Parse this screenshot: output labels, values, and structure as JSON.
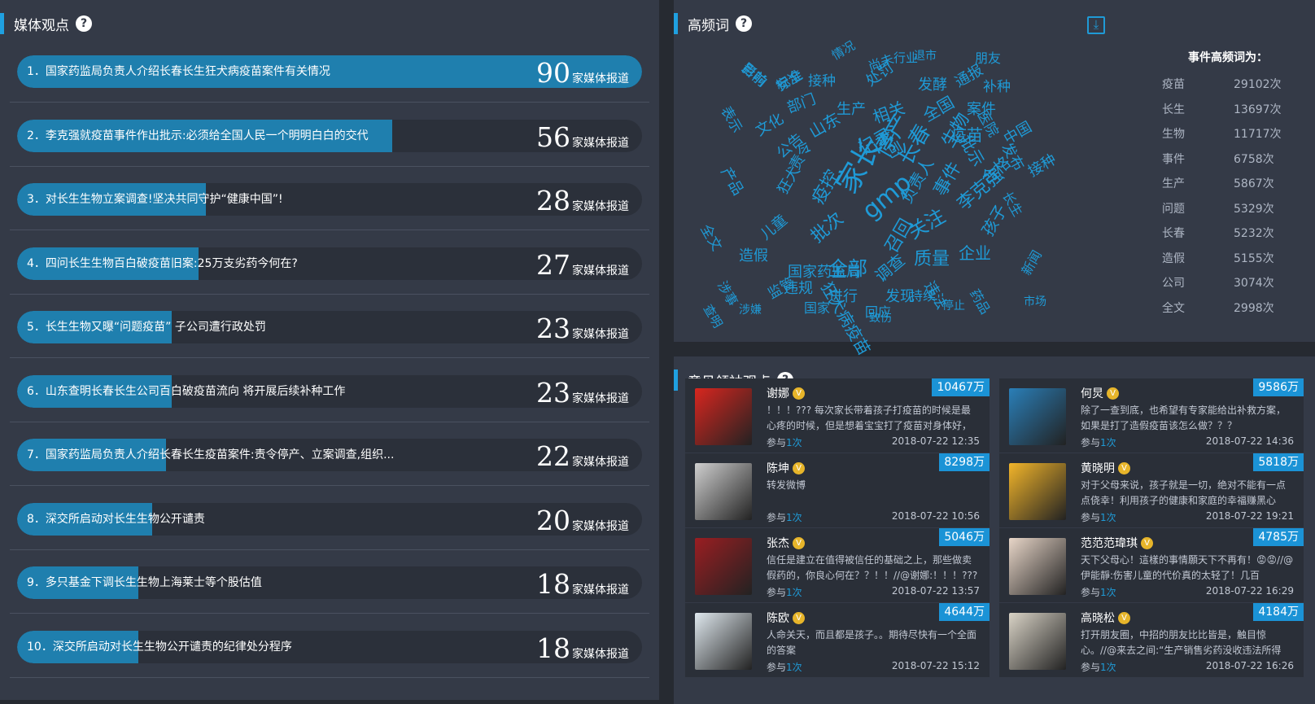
{
  "media": {
    "title": "媒体观点",
    "suffix": "家媒体报道",
    "items": [
      {
        "text": "1．国家药监局负责人介绍长春长生狂犬病疫苗案件有关情况",
        "count": 90,
        "fill": 1.0
      },
      {
        "text": "2．李克强就疫苗事件作出批示:必须给全国人民一个明明白白的交代",
        "count": 56,
        "fill": 0.6
      },
      {
        "text": "3．对长生生物立案调查!坚决共同守护“健康中国”!",
        "count": 28,
        "fill": 0.302
      },
      {
        "text": "4．四问长生生物百白破疫苗旧案:25万支劣药今何在?",
        "count": 27,
        "fill": 0.291
      },
      {
        "text": "5．长生生物又曝“问题疫苗”  子公司遭行政处罚",
        "count": 23,
        "fill": 0.248
      },
      {
        "text": "6．山东查明长春长生公司百白破疫苗流向 将开展后续补种工作",
        "count": 23,
        "fill": 0.248
      },
      {
        "text": "7．国家药监局负责人介绍长春长生疫苗案件:责令停产、立案调查,组织...",
        "count": 22,
        "fill": 0.238
      },
      {
        "text": "8．深交所启动对长生生物公开谴责",
        "count": 20,
        "fill": 0.216
      },
      {
        "text": "9．多只基金下调长生生物上海莱士等个股估值",
        "count": 18,
        "fill": 0.194
      },
      {
        "text": "10．深交所启动对长生生物公开谴责的纪律处分程序",
        "count": 18,
        "fill": 0.194
      }
    ]
  },
  "hf": {
    "title": "高频词",
    "freq_title": "事件高频词为：",
    "freq": [
      {
        "word": "疫苗",
        "count": "29102次"
      },
      {
        "word": "长生",
        "count": "13697次"
      },
      {
        "word": "生物",
        "count": "11717次"
      },
      {
        "word": "事件",
        "count": "6758次"
      },
      {
        "word": "生产",
        "count": "5867次"
      },
      {
        "word": "问题",
        "count": "5329次"
      },
      {
        "word": "长春",
        "count": "5232次"
      },
      {
        "word": "造假",
        "count": "5155次"
      },
      {
        "word": "公司",
        "count": "3074次"
      },
      {
        "word": "全文",
        "count": "2998次"
      }
    ],
    "cloud": [
      "目前",
      "安全",
      "接种",
      "情况",
      "尚未",
      "行业",
      "退市",
      "朋友",
      "处罚",
      "发酵",
      "通报",
      "补种",
      "表示",
      "部门",
      "生产",
      "相关",
      "全国",
      "案件",
      "医院",
      "文化",
      "山东",
      "记录",
      "公司",
      "疫苗",
      "批示",
      "中国",
      "发布",
      "公告",
      "责令",
      "停产",
      "长春",
      "生物",
      "事件",
      "接种",
      "产品",
      "狂犬",
      "疫控",
      "家长",
      "李克强",
      "合格",
      "长生",
      "儿童",
      "批次",
      "gmp",
      "负责人",
      "关注",
      "全文",
      "造假",
      "国家药监局",
      "全部",
      "召回",
      "质量",
      "企业",
      "孩子",
      "涉事",
      "违规",
      "狂犬病疫苗",
      "调查",
      "发现",
      "违法",
      "药品",
      "查明",
      "监管",
      "国家",
      "进行",
      "回应",
      "持续",
      "停止",
      "新闻",
      "市场",
      "涉嫌",
      "致伤",
      "影响",
      "标准"
    ]
  },
  "leaders": {
    "title": "意见领袖观点",
    "items": [
      {
        "name": "谢娜",
        "fans": "10467万",
        "text": "！！！??? 每次家长带着孩子打疫苗的时候是最心疼的时候，但是想着宝宝打了疫苗对身体好，就咬",
        "times_prefix": "参与",
        "times": "1次",
        "date": "2018-07-22 12:35",
        "color": "#d8261f"
      },
      {
        "name": "何炅",
        "fans": "9586万",
        "text": "除了一查到底，也希望有专家能给出补救方案，如果是打了造假疫苗该怎么做？？？",
        "times_prefix": "参与",
        "times": "1次",
        "date": "2018-07-22 14:36",
        "color": "#2a7fb8"
      },
      {
        "name": "陈坤",
        "fans": "8298万",
        "text": "转发微博",
        "times_prefix": "参与",
        "times": "1次",
        "date": "2018-07-22 10:56",
        "color": "#cfcfcf"
      },
      {
        "name": "黄晓明",
        "fans": "5818万",
        "text": "对于父母来说，孩子就是一切，绝对不能有一点点侥幸！利用孩子的健康和家庭的幸福赚黑心钱，良",
        "times_prefix": "参与",
        "times": "1次",
        "date": "2018-07-22 19:21",
        "color": "#f2b52a"
      },
      {
        "name": "张杰",
        "fans": "5046万",
        "text": "信任是建立在值得被信任的基础之上，那些做卖假药的，你良心何在？？！！//@谢娜:！！！??? 每",
        "times_prefix": "参与",
        "times": "1次",
        "date": "2018-07-22 13:57",
        "color": "#9a1e22"
      },
      {
        "name": "范范范瑋琪",
        "fans": "4785万",
        "text": "天下父母心！這樣的事情願天下不再有！😡😡//@伊能靜:伤害儿童的代价真的太轻了！几百",
        "times_prefix": "参与",
        "times": "1次",
        "date": "2018-07-22 16:29",
        "color": "#e8d6c8"
      },
      {
        "name": "陈欧",
        "fans": "4644万",
        "text": "人命关天，而且都是孩子。。期待尽快有一个全面的答案",
        "times_prefix": "参与",
        "times": "1次",
        "date": "2018-07-22 15:12",
        "color": "#dfe8ee"
      },
      {
        "name": "高晓松",
        "fans": "4184万",
        "text": "打开朋友圈，中招的朋友比比皆是，触目惊心。//@来去之间:“生产销售劣药没收违法所得",
        "times_prefix": "参与",
        "times": "1次",
        "date": "2018-07-22 16:26",
        "color": "#d9d3c6"
      }
    ]
  }
}
